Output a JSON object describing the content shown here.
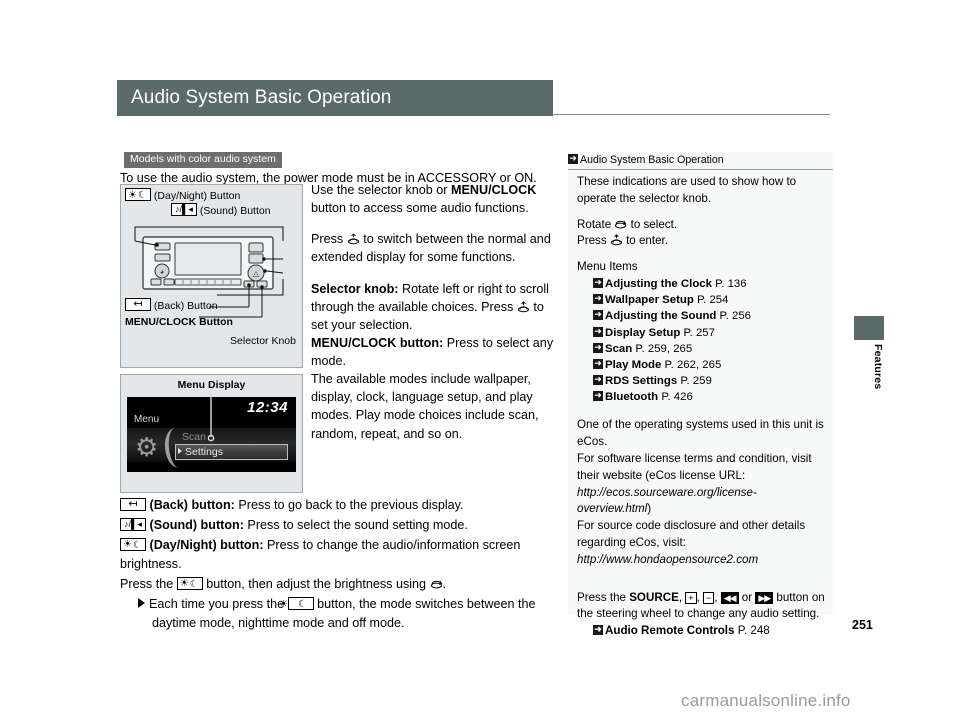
{
  "page": {
    "title": "Audio System Basic Operation",
    "number": "251",
    "edge_tab_label": "Features",
    "watermark": "carmanualsonline.info",
    "accent_color": "#5a6b6a"
  },
  "models_tag": "Models with color audio system",
  "lead_text": "To use the audio system, the power mode must be in ACCESSORY or ON.",
  "figure_unit": {
    "label_daynight": "(Day/Night) Button",
    "label_sound": "(Sound) Button",
    "label_back": "(Back) Button",
    "label_menuclock": "MENU/CLOCK Button",
    "label_selector_knob": "Selector Knob"
  },
  "figure_menu": {
    "caption": "Menu Display",
    "clock": "12:34",
    "menu_word": "Menu",
    "row_scan": "Scan",
    "row_settings": "Settings"
  },
  "center_text": {
    "p1_a": "Use the selector knob or ",
    "p1_b": "MENU/CLOCK",
    "p1_c": " button to access some audio functions.",
    "p2_a": "Press ",
    "p2_b": " to switch between the normal and extended display for some functions.",
    "p3_label": "Selector knob:",
    "p3_a": " Rotate left or right to scroll through the available choices. Press ",
    "p3_b": " to set your selection.",
    "p4_label": "MENU/CLOCK button:",
    "p4_a": " Press to select any mode.",
    "p5": "The available modes include wallpaper, display, clock, language setup, and play modes. Play mode choices include scan, random, repeat, and so on."
  },
  "bottom_text": {
    "back_label": "(Back) button:",
    "back_desc": " Press to go back to the previous display.",
    "sound_label": "(Sound) button:",
    "sound_desc": " Press to select the sound setting mode.",
    "daynight_label": "(Day/Night) button:",
    "daynight_desc": " Press to change the audio/information screen brightness.",
    "press_a": "Press the ",
    "press_b": " button, then adjust the brightness using ",
    "press_c": ".",
    "bullet_a": "Each time you press the ",
    "bullet_b": " button, the mode switches between the daytime mode, nighttime mode and off mode."
  },
  "sidebar": {
    "heading": "Audio System Basic Operation",
    "intro": "These indications are used to show how to operate the selector knob.",
    "rotate_a": "Rotate ",
    "rotate_b": " to select.",
    "press_a": "Press ",
    "press_b": " to enter.",
    "menu_items_title": "Menu Items",
    "menu_items": [
      {
        "name": "Adjusting the Clock",
        "page": "P. 136"
      },
      {
        "name": "Wallpaper Setup",
        "page": "P. 254"
      },
      {
        "name": "Adjusting the Sound",
        "page": "P. 256"
      },
      {
        "name": "Display Setup",
        "page": "P. 257"
      },
      {
        "name": "Scan",
        "page": "P. 259, 265"
      },
      {
        "name": "Play Mode",
        "page": "P. 262, 265"
      },
      {
        "name": "RDS Settings",
        "page": "P. 259"
      },
      {
        "name": "Bluetooth",
        "page": "P. 426"
      }
    ],
    "ecos_1": "One of the operating systems used in this unit is eCos.",
    "ecos_2": "For software license terms and condition, visit their website (eCos license URL:",
    "ecos_url1": "http://ecos.sourceware.org/license-overview.html",
    "ecos_2b": ")",
    "ecos_3": "For source code disclosure and other details regarding eCos, visit:",
    "ecos_url2": "http://www.hondaopensource2.com",
    "remote_a": "Press the ",
    "remote_source": "SOURCE",
    "remote_plus": "+",
    "remote_minus": "−",
    "remote_prev": "◀◀",
    "remote_next": "▶▶",
    "remote_b": " button on the steering wheel to change any audio setting.",
    "remote_ref": "Audio Remote Controls",
    "remote_ref_page": "P. 248"
  }
}
